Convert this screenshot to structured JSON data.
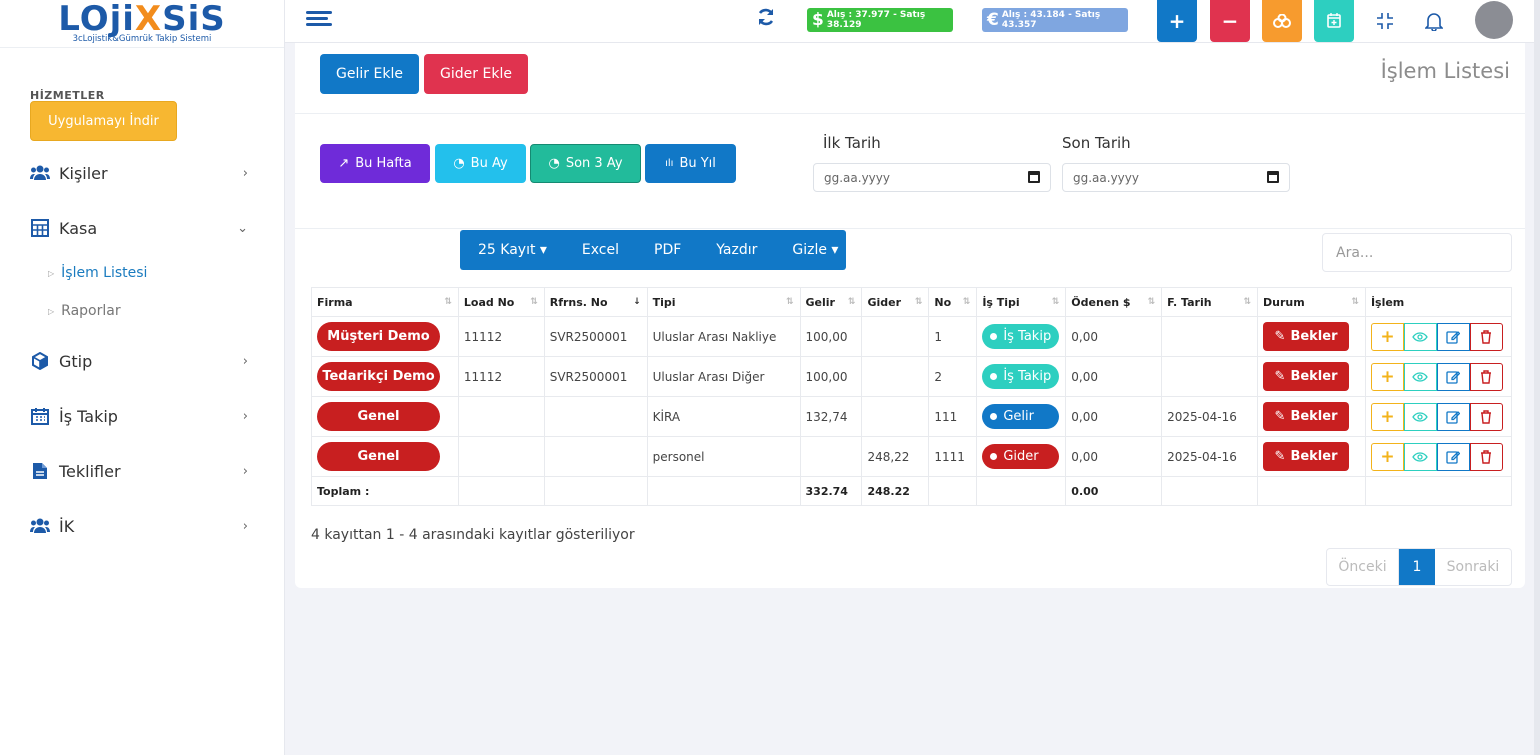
{
  "logo": {
    "word_a": "LOji",
    "word_x": "X",
    "word_b": "SiS",
    "subtitle": "3cLojistik&Gümrük Takip Sistemi"
  },
  "sidebar": {
    "section_label": "HİZMETLER",
    "download_label": "Uygulamayı İndir",
    "items": [
      {
        "label": "Kişiler",
        "icon": "users-icon",
        "chevron": "›"
      },
      {
        "label": "Kasa",
        "icon": "calculator-icon",
        "chevron": "⌄"
      },
      {
        "label": "Gtip",
        "icon": "cube-icon",
        "chevron": "›"
      },
      {
        "label": "İş Takip",
        "icon": "calendar-icon",
        "chevron": "›"
      },
      {
        "label": "Teklifler",
        "icon": "file-icon",
        "chevron": "›"
      },
      {
        "label": "İK",
        "icon": "users-icon",
        "chevron": "›"
      }
    ],
    "sub_items": [
      {
        "label": "İşlem Listesi",
        "active": true
      },
      {
        "label": "Raporlar",
        "active": false
      }
    ]
  },
  "topbar": {
    "usd_rate": "Alış : 37.977 - Satış 38.129",
    "eur_rate": "Alış : 43.184 - Satış 43.357",
    "usd_symbol": "$",
    "eur_symbol": "€",
    "colors": {
      "add": "#1178c7",
      "remove": "#e0334f",
      "coins": "#f79b2e",
      "calendar": "#2dcfc0"
    }
  },
  "page": {
    "gelir_button": "Gelir Ekle",
    "gider_button": "Gider Ekle",
    "title": "İşlem Listesi",
    "periods": [
      {
        "label": "Bu Hafta",
        "icon": "↗",
        "color": "#6f2bd9"
      },
      {
        "label": "Bu Ay",
        "icon": "◔",
        "color": "#23c0ec"
      },
      {
        "label": "Son 3 Ay",
        "icon": "◔",
        "color": "#22bb9b"
      },
      {
        "label": "Bu Yıl",
        "icon": "ılı",
        "color": "#1178c7"
      }
    ],
    "start_date_label": "İlk Tarih",
    "end_date_label": "Son Tarih",
    "date_placeholder": "gg.aa.yyyy",
    "dt_buttons": [
      "25 Kayıt ▾",
      "Excel",
      "PDF",
      "Yazdır",
      "Gizle ▾"
    ],
    "search_placeholder": "Ara..."
  },
  "table": {
    "headers": [
      "Firma",
      "Load No",
      "Rfrns. No",
      "Tipi",
      "Gelir",
      "Gider",
      "No",
      "İş Tipi",
      "Ödenen $",
      "F. Tarih",
      "Durum",
      "İşlem"
    ],
    "rows": [
      {
        "firma": "Müşteri Demo",
        "load": "11112",
        "ref": "SVR2500001",
        "tipi": "Uluslar Arası Nakliye",
        "gelir": "100,00",
        "gider": "",
        "no": "1",
        "is_tipi": "İş Takip",
        "is_tipi_kind": "takip",
        "odenen": "0,00",
        "tarih": "",
        "durum": "Bekler"
      },
      {
        "firma": "Tedarikçi Demo",
        "load": "11112",
        "ref": "SVR2500001",
        "tipi": "Uluslar Arası Diğer",
        "gelir": "100,00",
        "gider": "",
        "no": "2",
        "is_tipi": "İş Takip",
        "is_tipi_kind": "takip",
        "odenen": "0,00",
        "tarih": "",
        "durum": "Bekler"
      },
      {
        "firma": "Genel",
        "load": "",
        "ref": "",
        "tipi": "KİRA",
        "gelir": "132,74",
        "gider": "",
        "no": "111",
        "is_tipi": "Gelir",
        "is_tipi_kind": "gelir",
        "odenen": "0,00",
        "tarih": "2025-04-16",
        "durum": "Bekler"
      },
      {
        "firma": "Genel",
        "load": "",
        "ref": "",
        "tipi": "personel",
        "gelir": "",
        "gider": "248,22",
        "no": "1111",
        "is_tipi": "Gider",
        "is_tipi_kind": "gider",
        "odenen": "0,00",
        "tarih": "2025-04-16",
        "durum": "Bekler"
      }
    ],
    "total_label": "Toplam :",
    "total_gelir": "332.74",
    "total_gider": "248.22",
    "total_odenen": "0.00"
  },
  "footer": {
    "info": "4 kayıttan 1 - 4 arasındaki kayıtlar gösteriliyor",
    "prev": "Önceki",
    "current": "1",
    "next": "Sonraki"
  }
}
